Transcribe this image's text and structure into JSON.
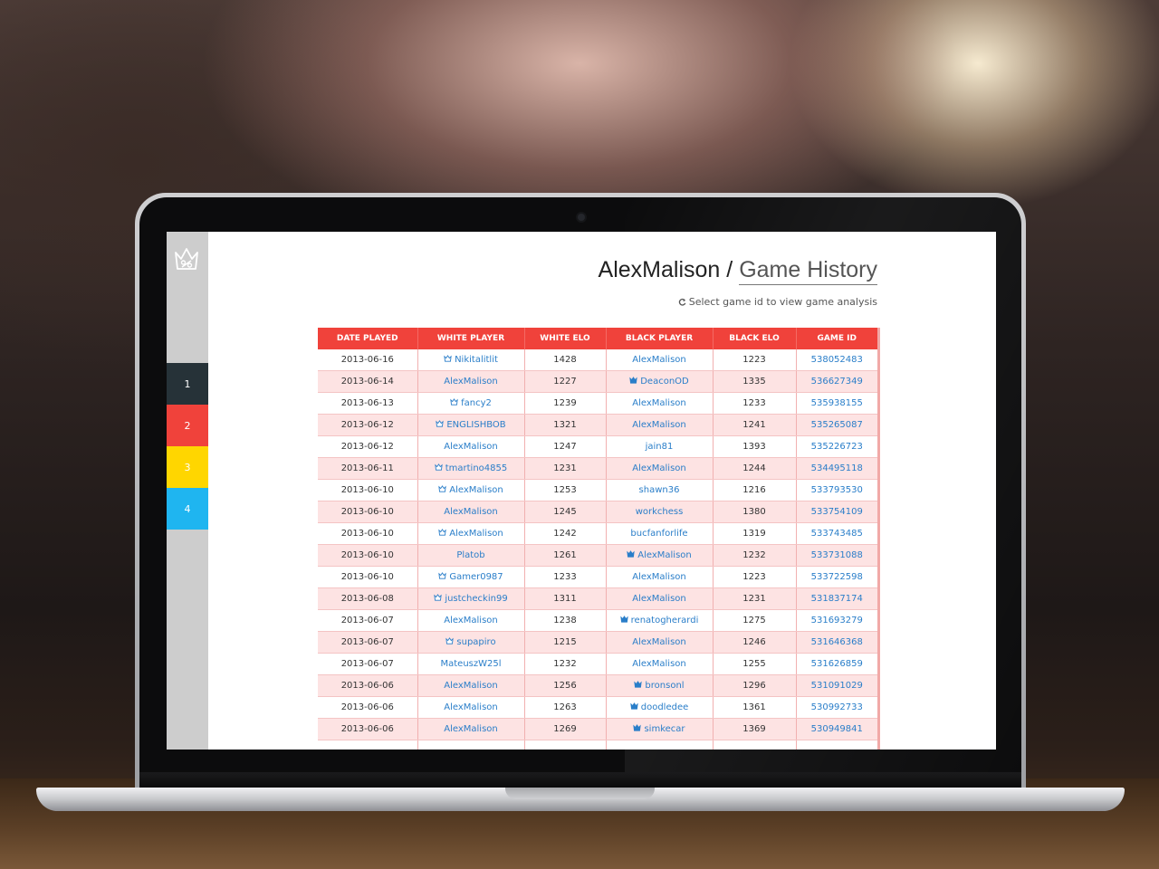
{
  "header": {
    "user": "AlexMalison",
    "separator": "/",
    "page": "Game History",
    "hint": "Select game id to view game analysis"
  },
  "sidebar": {
    "logo_icon": "crown-logo-icon",
    "items": [
      {
        "label": "1",
        "color": "#263238"
      },
      {
        "label": "2",
        "color": "#f0423b"
      },
      {
        "label": "3",
        "color": "#ffd600"
      },
      {
        "label": "4",
        "color": "#1fb5f0"
      }
    ]
  },
  "table": {
    "columns": [
      "DATE PLAYED",
      "WHITE PLAYER",
      "WHITE ELO",
      "BLACK PLAYER",
      "BLACK ELO",
      "GAME ID"
    ],
    "rows": [
      {
        "date": "2013-06-16",
        "white": "Nikitalitlit",
        "white_icon": "white-pawn-icon",
        "white_elo": "1428",
        "black": "AlexMalison",
        "black_icon": "",
        "black_elo": "1223",
        "game_id": "538052483"
      },
      {
        "date": "2013-06-14",
        "white": "AlexMalison",
        "white_icon": "",
        "white_elo": "1227",
        "black": "DeaconOD",
        "black_icon": "black-pawn-icon",
        "black_elo": "1335",
        "game_id": "536627349"
      },
      {
        "date": "2013-06-13",
        "white": "fancy2",
        "white_icon": "white-pawn-icon",
        "white_elo": "1239",
        "black": "AlexMalison",
        "black_icon": "",
        "black_elo": "1233",
        "game_id": "535938155"
      },
      {
        "date": "2013-06-12",
        "white": "ENGLISHBOB",
        "white_icon": "white-pawn-icon",
        "white_elo": "1321",
        "black": "AlexMalison",
        "black_icon": "",
        "black_elo": "1241",
        "game_id": "535265087"
      },
      {
        "date": "2013-06-12",
        "white": "AlexMalison",
        "white_icon": "",
        "white_elo": "1247",
        "black": "jain81",
        "black_icon": "",
        "black_elo": "1393",
        "game_id": "535226723"
      },
      {
        "date": "2013-06-11",
        "white": "tmartino4855",
        "white_icon": "white-pawn-icon",
        "white_elo": "1231",
        "black": "AlexMalison",
        "black_icon": "",
        "black_elo": "1244",
        "game_id": "534495118"
      },
      {
        "date": "2013-06-10",
        "white": "AlexMalison",
        "white_icon": "white-pawn-icon",
        "white_elo": "1253",
        "black": "shawn36",
        "black_icon": "",
        "black_elo": "1216",
        "game_id": "533793530"
      },
      {
        "date": "2013-06-10",
        "white": "AlexMalison",
        "white_icon": "",
        "white_elo": "1245",
        "black": "workchess",
        "black_icon": "",
        "black_elo": "1380",
        "game_id": "533754109"
      },
      {
        "date": "2013-06-10",
        "white": "AlexMalison",
        "white_icon": "white-pawn-icon",
        "white_elo": "1242",
        "black": "bucfanforlife",
        "black_icon": "",
        "black_elo": "1319",
        "game_id": "533743485"
      },
      {
        "date": "2013-06-10",
        "white": "Platob",
        "white_icon": "",
        "white_elo": "1261",
        "black": "AlexMalison",
        "black_icon": "black-pawn-icon",
        "black_elo": "1232",
        "game_id": "533731088"
      },
      {
        "date": "2013-06-10",
        "white": "Gamer0987",
        "white_icon": "white-pawn-icon",
        "white_elo": "1233",
        "black": "AlexMalison",
        "black_icon": "",
        "black_elo": "1223",
        "game_id": "533722598"
      },
      {
        "date": "2013-06-08",
        "white": "justcheckin99",
        "white_icon": "white-pawn-icon",
        "white_elo": "1311",
        "black": "AlexMalison",
        "black_icon": "",
        "black_elo": "1231",
        "game_id": "531837174"
      },
      {
        "date": "2013-06-07",
        "white": "AlexMalison",
        "white_icon": "",
        "white_elo": "1238",
        "black": "renatogherardi",
        "black_icon": "black-pawn-icon",
        "black_elo": "1275",
        "game_id": "531693279"
      },
      {
        "date": "2013-06-07",
        "white": "supapiro",
        "white_icon": "white-pawn-icon",
        "white_elo": "1215",
        "black": "AlexMalison",
        "black_icon": "",
        "black_elo": "1246",
        "game_id": "531646368"
      },
      {
        "date": "2013-06-07",
        "white": "MateuszW25l",
        "white_icon": "",
        "white_elo": "1232",
        "black": "AlexMalison",
        "black_icon": "",
        "black_elo": "1255",
        "game_id": "531626859"
      },
      {
        "date": "2013-06-06",
        "white": "AlexMalison",
        "white_icon": "",
        "white_elo": "1256",
        "black": "bronsonl",
        "black_icon": "black-pawn-icon",
        "black_elo": "1296",
        "game_id": "531091029"
      },
      {
        "date": "2013-06-06",
        "white": "AlexMalison",
        "white_icon": "",
        "white_elo": "1263",
        "black": "doodledee",
        "black_icon": "black-pawn-icon",
        "black_elo": "1361",
        "game_id": "530992733"
      },
      {
        "date": "2013-06-06",
        "white": "AlexMalison",
        "white_icon": "",
        "white_elo": "1269",
        "black": "simkecar",
        "black_icon": "black-pawn-icon",
        "black_elo": "1369",
        "game_id": "530949841"
      },
      {
        "date": "",
        "white": "",
        "white_icon": "",
        "white_elo": "",
        "black": "",
        "black_icon": "",
        "black_elo": "",
        "game_id": ""
      }
    ]
  }
}
